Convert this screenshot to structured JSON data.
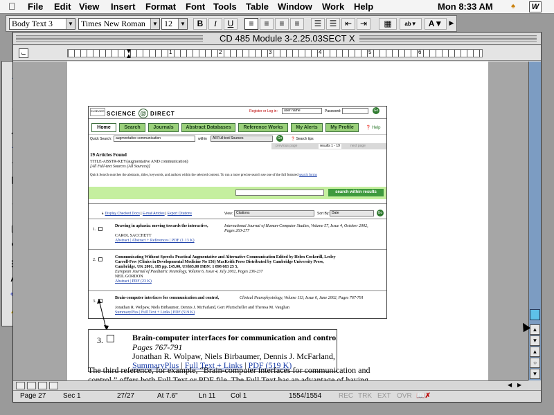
{
  "menubar": {
    "items": [
      "File",
      "Edit",
      "View",
      "Insert",
      "Format",
      "Font",
      "Tools",
      "Table",
      "Window",
      "Work",
      "Help"
    ],
    "clock": "Mon 8:33 AM"
  },
  "toolbar": {
    "style": "Body Text 3",
    "font": "Times New Roman",
    "size": "12",
    "bold": "B",
    "italic": "I",
    "underline": "U"
  },
  "window": {
    "title": "CD 485 Module 3-2.25.03SECT X"
  },
  "ruler": {
    "numbers": [
      "1",
      "2",
      "3",
      "4",
      "5",
      "6"
    ]
  },
  "sciencedirect": {
    "brand": "SCIENCE",
    "at": "@",
    "brand2": "DIRECT",
    "elsevier": "ELSEVIER",
    "register": "Register or Log in:",
    "user_placeholder": "user name",
    "password_label": "Password:",
    "go": "Go",
    "tabs": [
      "Home",
      "Search",
      "Journals",
      "Abstract Databases",
      "Reference Works",
      "My Alerts",
      "My Profile"
    ],
    "help": "Help",
    "quick_search_label": "Quick Search:",
    "quick_search_value": "augmentative communication",
    "within_label": "within",
    "within_value": "All Full-text Sources",
    "search_tips": "Search tips",
    "prev_page": "previous page",
    "results": "results 1 - 19",
    "next_page": "next page",
    "found": "19 Articles Found",
    "query": "TITLE-ABSTR-KEY(augmentative AND communication)",
    "query2": "[All Full-text Sources (All Sources)]",
    "quick_desc": "Quick Search searches the abstracts, titles, keywords, and authors within the selected content. To run a more precise search use one of the full featured",
    "search_forms": "search forms",
    "search_within": "search within results",
    "display_checked": "Display Checked Docs",
    "email_articles": "E-mail Articles",
    "export_citations": "Export Citations",
    "view_label": "View:",
    "view_value": "Citations",
    "sortby_label": "Sort By:",
    "sortby_value": "Date",
    "results_list": [
      {
        "num": "1.",
        "title": "Drawing in aphasia: moving towards the interactive,",
        "source": "International Journal of Human-Computer Studies, Volume 57, Issue 4, October 2002, Pages 263-277",
        "author": "CAROL SACCHETT",
        "links": "Abstract | Abstract + References | PDF (1.13 K)"
      },
      {
        "num": "2.",
        "title": "Communicating Without Speech: Practical Augmentative and Alternative Communication Edited by Helen Cockerill, Lesley",
        "line2": "Carroll-Few (Clinics in Developmental Medicine No 156) MacKeith Press Distributed by Cambridge University Press,",
        "line3": "Cambridge, UK 2001, 185 pp. £45.00, US$65.00 ISBN: 1 898 683 25 5,",
        "source": "European Journal of Paediatric Neurology, Volume 6, Issue 4, July 2002, Pages 236-237",
        "author": "NEIL GORDON",
        "links": "Abstract | PDF (23 K)"
      },
      {
        "num": "3.",
        "title": "Brain-computer interfaces for communication and control,",
        "source": "Clinical Neurophysiology, Volume 113, Issue 6, June 2002, Pages 767-791",
        "author": "Jonathan R. Wolpaw, Niels Birbaumer, Dennis J. McFarland, Gert Pfurtscheller and Theresa M. Vaughan",
        "links": "SummaryPlus | Full Text + Links | PDF (519 K)"
      }
    ]
  },
  "zoom": {
    "num": "3.",
    "title": "Brain-computer interfaces for communication and control,",
    "pages": "Pages 767-791",
    "authors": "Jonathan R. Wolpaw, Niels Birbaumer, Dennis J. McFarland, Ger",
    "link1": "SummaryPlus",
    "sep": "|",
    "link2": "Full Text + Links",
    "link3": "PDF (519 K)"
  },
  "body_text": {
    "line1": "The third reference, for example, “Brain-computer interfaces for communication and",
    "line2": "control,” offers both Full Text or PDF file.  The Full Text has an advantage of having"
  },
  "status": {
    "page": "Page 27",
    "sec": "Sec 1",
    "pages": "27/27",
    "at": "At 7.6\"",
    "ln": "Ln 11",
    "col": "Col 1",
    "words": "1554/1554",
    "rec": "REC",
    "trk": "TRK",
    "ext": "EXT",
    "ovr": "OVR"
  },
  "colors": {
    "green_tab": "#9ad07a",
    "green_bar": "#c5ef9f",
    "link": "#1a3ea8",
    "scrollbar": "#7c9cc2",
    "scroll_thumb": "#5ec1e8"
  }
}
